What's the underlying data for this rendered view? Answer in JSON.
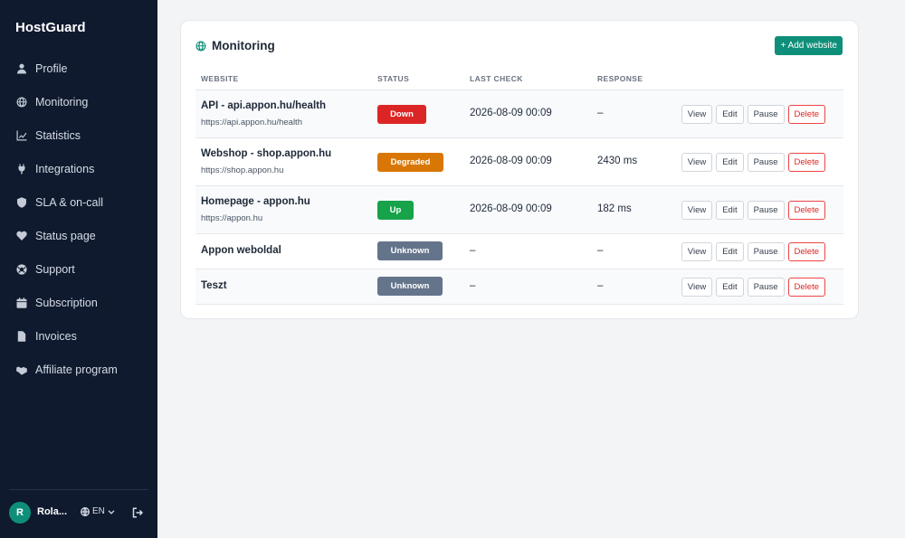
{
  "sidebar": {
    "brand": "HostGuard",
    "items": [
      {
        "label": "Profile",
        "icon": "user-icon"
      },
      {
        "label": "Monitoring",
        "icon": "globe-icon"
      },
      {
        "label": "Statistics",
        "icon": "chart-line-icon"
      },
      {
        "label": "Integrations",
        "icon": "plug-icon"
      },
      {
        "label": "SLA & on-call",
        "icon": "shield-icon"
      },
      {
        "label": "Status page",
        "icon": "heart-pulse-icon"
      },
      {
        "label": "Support",
        "icon": "life-ring-icon"
      },
      {
        "label": "Subscription",
        "icon": "calendar-icon"
      },
      {
        "label": "Invoices",
        "icon": "document-icon"
      },
      {
        "label": "Affiliate program",
        "icon": "handshake-icon"
      }
    ],
    "user": {
      "initial": "R",
      "name": "Rola..."
    },
    "language": "EN"
  },
  "monitoring": {
    "title": "Monitoring",
    "add_label": "+ Add website",
    "columns": {
      "website": "WEBSITE",
      "status": "STATUS",
      "last_check": "LAST CHECK",
      "response": "RESPONSE"
    },
    "actions": {
      "view": "View",
      "edit": "Edit",
      "pause": "Pause",
      "delete": "Delete"
    },
    "rows": [
      {
        "name": "API - api.appon.hu/health",
        "url": "https://api.appon.hu/health",
        "status": "Down",
        "last_check": "2026-08-09 00:09",
        "response": "–"
      },
      {
        "name": "Webshop - shop.appon.hu",
        "url": "https://shop.appon.hu",
        "status": "Degraded",
        "last_check": "2026-08-09 00:09",
        "response": "2430 ms"
      },
      {
        "name": "Homepage - appon.hu",
        "url": "https://appon.hu",
        "status": "Up",
        "last_check": "2026-08-09 00:09",
        "response": "182 ms"
      },
      {
        "name": "Appon weboldal",
        "url": "",
        "status": "Unknown",
        "last_check": "–",
        "response": "–"
      },
      {
        "name": "Teszt",
        "url": "",
        "status": "Unknown",
        "last_check": "–",
        "response": "–"
      }
    ]
  },
  "colors": {
    "sidebar_bg": "#0f1a2e",
    "accent": "#0f8f7a",
    "status_down": "#dc2626",
    "status_degraded": "#d97706",
    "status_up": "#16a34a",
    "status_unknown": "#64748b"
  }
}
